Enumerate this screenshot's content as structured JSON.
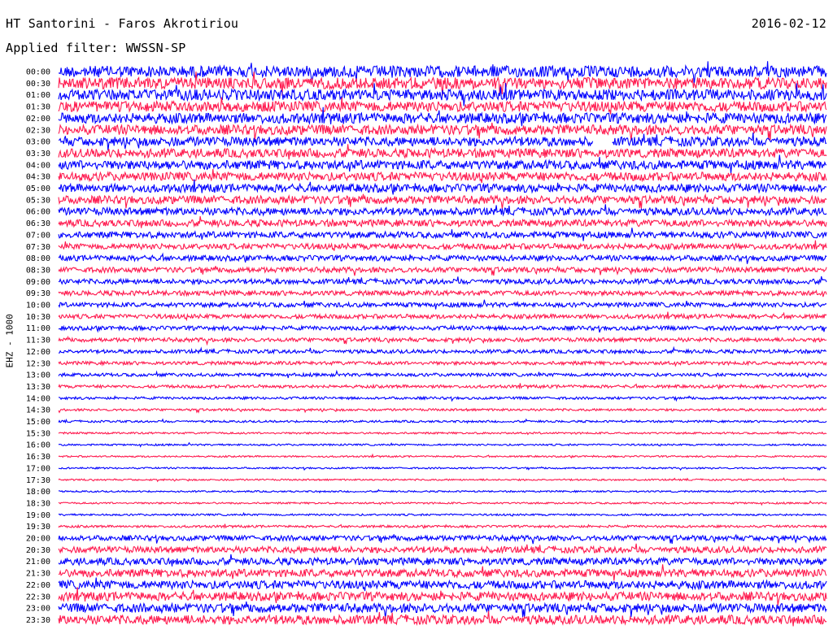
{
  "header": {
    "station": "HT Santorini - Faros Akrotiriou",
    "date": "2016-02-12",
    "filter": "Applied filter: WWSSN-SP"
  },
  "colors": {
    "even_trace": "#0000ff",
    "odd_trace": "#ff1a4f"
  },
  "chart_data": {
    "type": "line",
    "ylabel": "EHZ - 1000",
    "x_unit": "minutes",
    "xlim": [
      0,
      30
    ],
    "row_labels": [
      "00:00",
      "00:30",
      "01:00",
      "01:30",
      "02:00",
      "02:30",
      "03:00",
      "03:30",
      "04:00",
      "04:30",
      "05:00",
      "05:30",
      "06:00",
      "06:30",
      "07:00",
      "07:30",
      "08:00",
      "08:30",
      "09:00",
      "09:30",
      "10:00",
      "10:30",
      "11:00",
      "11:30",
      "12:00",
      "12:30",
      "13:00",
      "13:30",
      "14:00",
      "14:30",
      "15:00",
      "15:30",
      "16:00",
      "16:30",
      "17:00",
      "17:30",
      "18:00",
      "18:30",
      "19:00",
      "19:30",
      "20:00",
      "20:30",
      "21:00",
      "21:30",
      "22:00",
      "22:30",
      "23:00",
      "23:30"
    ],
    "noise_amplitude": [
      1.0,
      1.0,
      0.95,
      0.9,
      0.9,
      0.85,
      0.8,
      0.78,
      0.78,
      0.75,
      0.72,
      0.7,
      0.65,
      0.6,
      0.55,
      0.5,
      0.48,
      0.46,
      0.44,
      0.42,
      0.4,
      0.38,
      0.36,
      0.34,
      0.32,
      0.3,
      0.28,
      0.26,
      0.22,
      0.2,
      0.18,
      0.16,
      0.15,
      0.14,
      0.14,
      0.14,
      0.14,
      0.15,
      0.16,
      0.2,
      0.45,
      0.55,
      0.62,
      0.68,
      0.72,
      0.75,
      0.78,
      0.8
    ],
    "gaps": [
      {
        "row": "03:00",
        "start_min": 20.9,
        "end_min": 21.6
      }
    ]
  }
}
